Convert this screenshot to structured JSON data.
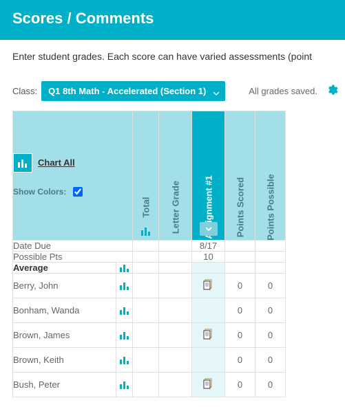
{
  "header": {
    "title": "Scores / Comments"
  },
  "instruction": "Enter student grades. Each score can have varied assessments (point",
  "toolbar": {
    "class_label": "Class:",
    "class_value": "Q1 8th Math - Accelerated (Section 1)",
    "saved_text": "All grades saved."
  },
  "corner": {
    "chart_all": "Chart All",
    "show_colors": "Show Colors:",
    "show_colors_checked": true
  },
  "columns": {
    "total": "Total",
    "letter_grade": "Letter Grade",
    "assignment": "Assignment #1",
    "points_scored": "Points Scored",
    "points_possible": "Points Possible"
  },
  "meta_rows": {
    "date_due": {
      "label": "Date Due",
      "assignment": "8/17"
    },
    "possible_pts": {
      "label": "Possible Pts",
      "assignment": "10"
    },
    "average": {
      "label": "Average"
    }
  },
  "students": [
    {
      "name": "Berry, John",
      "has_comment": true,
      "scored": "0",
      "possible": "0"
    },
    {
      "name": "Bonham, Wanda",
      "has_comment": false,
      "scored": "0",
      "possible": "0"
    },
    {
      "name": "Brown, James",
      "has_comment": true,
      "scored": "0",
      "possible": "0"
    },
    {
      "name": "Brown, Keith",
      "has_comment": false,
      "scored": "0",
      "possible": "0"
    },
    {
      "name": "Bush, Peter",
      "has_comment": true,
      "scored": "0",
      "possible": "0"
    }
  ]
}
